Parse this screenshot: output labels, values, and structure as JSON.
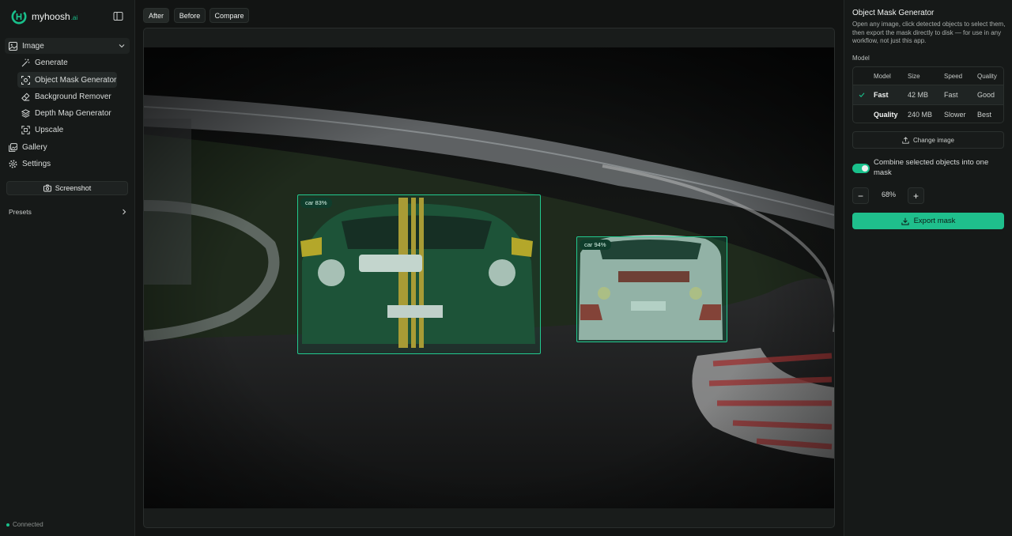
{
  "brand": {
    "name": "myhoosh",
    "suffix": ".ai"
  },
  "nav": {
    "image_group": "Image",
    "sub_items": [
      "Generate",
      "Object Mask Generator",
      "Background Remover",
      "Depth Map Generator",
      "Upscale"
    ],
    "gallery": "Gallery",
    "settings": "Settings",
    "screenshot": "Screenshot",
    "presets": "Presets"
  },
  "status": {
    "text": "Connected",
    "color": "#19c08b"
  },
  "view_tabs": [
    "After",
    "Before",
    "Compare"
  ],
  "detections": [
    {
      "label": "car 83%"
    },
    {
      "label": "car 94%"
    }
  ],
  "panel": {
    "title": "Object Mask Generator",
    "description": "Open any image, click detected objects to select them, then export the mask directly to disk — for use in any workflow, not just this app.",
    "model_label": "Model",
    "table": {
      "headers": [
        "Model",
        "Size",
        "Speed",
        "Quality"
      ],
      "rows": [
        {
          "name": "Fast",
          "size": "42 MB",
          "speed": "Fast",
          "quality": "Good",
          "selected": true
        },
        {
          "name": "Quality",
          "size": "240 MB",
          "speed": "Slower",
          "quality": "Best",
          "selected": false
        }
      ]
    },
    "change_image": "Change image",
    "combine_label": "Combine selected objects into one mask",
    "combine_enabled": true,
    "stepper": {
      "minus": "−",
      "value": "68%",
      "plus": "+"
    },
    "export": "Export mask"
  },
  "colors": {
    "accent": "#1fbf8c",
    "background": "#121413",
    "box": "#22c98f"
  }
}
